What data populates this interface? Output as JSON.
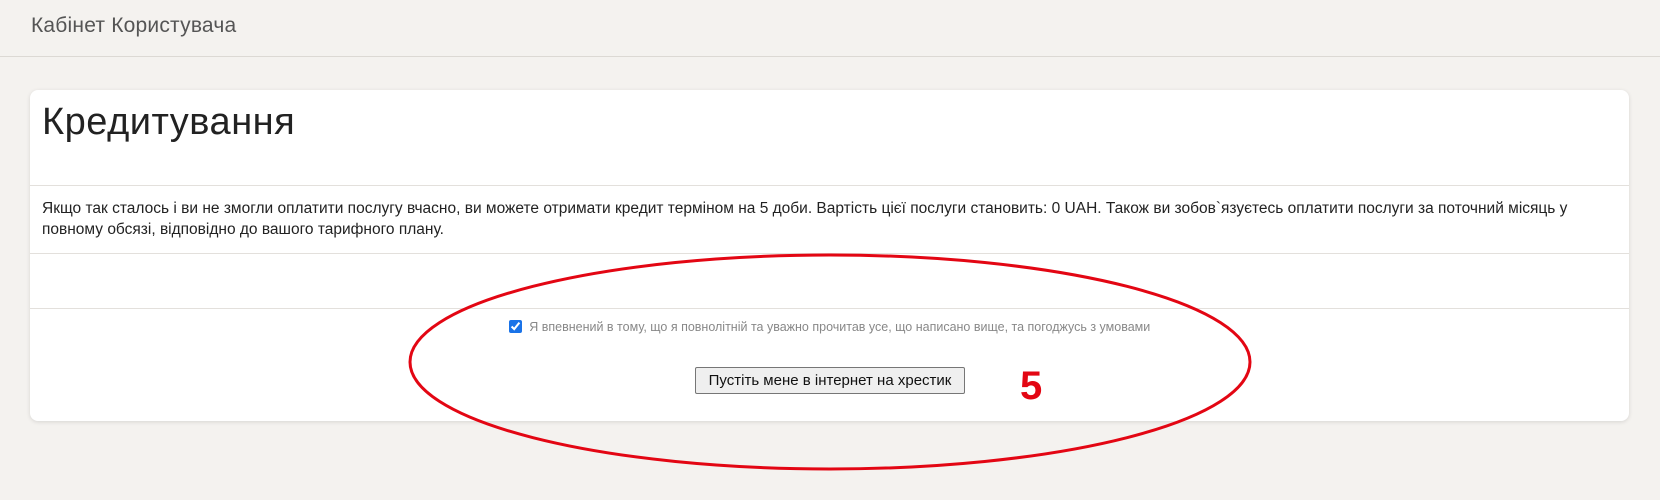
{
  "header": {
    "title": "Кабінет Користувача"
  },
  "card": {
    "title": "Кредитування",
    "description": "Якщо так сталось і ви не змогли оплатити послугу вчасно, ви можете отримати кредит терміном на 5 доби. Вартість цієї послуги становить: 0 UAH. Також ви зобов`язуєтесь оплатити послуги за поточний місяць у повному обсязі, відповідно до вашого тарифного плану.",
    "agree_label": "Я впевнений в тому, що я повнолітній та уважно прочитав усе, що написано вище, та погоджусь з умовами",
    "agree_checked": true,
    "submit_label": "Пустіть мене в інтернет на хрестик"
  },
  "annotation": {
    "step_number": "5",
    "color": "#e30613"
  },
  "colors": {
    "background": "#f4f2ef",
    "card": "#ffffff",
    "checkbox_accent": "#1a73e8"
  }
}
